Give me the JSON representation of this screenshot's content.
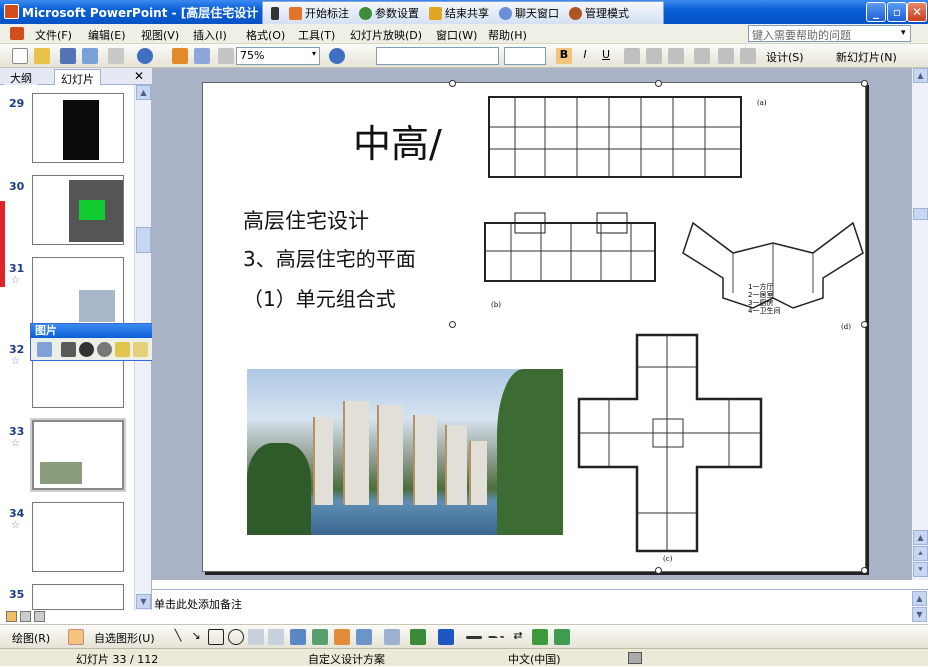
{
  "window": {
    "title": "Microsoft PowerPoint - [高层住宅设计"
  },
  "meeting_bar": {
    "items": [
      "开始标注",
      "参数设置",
      "结束共享",
      "聊天窗口",
      "管理模式"
    ]
  },
  "menu": {
    "items": [
      "文件(F)",
      "编辑(E)",
      "视图(V)",
      "插入(I)",
      "格式(O)",
      "工具(T)",
      "幻灯片放映(D)",
      "窗口(W)",
      "帮助(H)"
    ]
  },
  "help_placeholder": "键入需要帮助的问题",
  "toolbar": {
    "zoom": "75%",
    "design_label": "设计(S)",
    "new_slide_label": "新幻灯片(N)"
  },
  "panel_tabs": [
    "大纲",
    "幻灯片"
  ],
  "thumbnails": [
    {
      "num": "29"
    },
    {
      "num": "30"
    },
    {
      "num": "31"
    },
    {
      "num": "32"
    },
    {
      "num": "33"
    },
    {
      "num": "34"
    },
    {
      "num": "35"
    }
  ],
  "picture_toolbar": {
    "title": "图片"
  },
  "slide": {
    "title": "中高/",
    "lines": [
      "高层住宅设计",
      "3、高层住宅的平面",
      "（1）单元组合式"
    ],
    "plan_legend": [
      "1一方厅",
      "2一居室",
      "3一厨房",
      "4一卫生间"
    ],
    "captions": [
      "(a)",
      "(b)",
      "(d)",
      "(c)"
    ]
  },
  "notes_placeholder": "单击此处添加备注",
  "drawing_bar": {
    "draw_label": "绘图(R)",
    "autoshape_label": "自选图形(U)"
  },
  "status": {
    "slide": "幻灯片 33 / 112",
    "design": "自定义设计方案",
    "lang": "中文(中国)"
  },
  "colors": {
    "title_bar": "#0a5fd8",
    "slide_bg": "#ffffff",
    "work_area": "#aab3c5"
  }
}
